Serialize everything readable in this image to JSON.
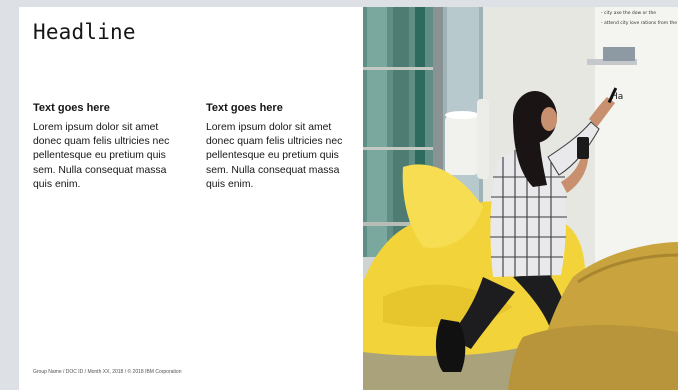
{
  "slide": {
    "headline": "Headline",
    "columns": [
      {
        "title": "Text goes here",
        "body": "Lorem ipsum dolor sit amet donec quam felis ultricies nec pellentesque eu pretium quis sem. Nulla consequat massa quis enim."
      },
      {
        "title": "Text goes here",
        "body": "Lorem ipsum dolor sit amet donec quam felis ultricies nec pellentesque eu pretium quis sem. Nulla consequat massa quis enim."
      }
    ],
    "footer": "Group Name / DOC ID / Month XX, 2018 / © 2018 IBM Corporation"
  },
  "photo": {
    "whiteboard_lines": [
      "- city axe the dow or the",
      "- attend city love rations from the"
    ],
    "whiteboard_marker_text": "Ha"
  },
  "colors": {
    "page_background": "#dde1e6",
    "text": "#161616",
    "beanbag_yellow": "#f2d33a",
    "chair_mustard": "#c9a43e"
  }
}
